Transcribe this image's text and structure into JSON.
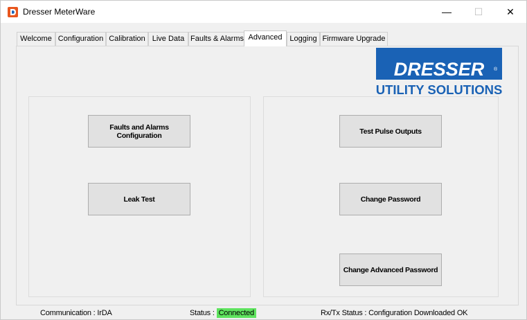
{
  "window": {
    "title": "Dresser MeterWare",
    "minimize_glyph": "—",
    "maximize_glyph": "☐",
    "close_glyph": "✕"
  },
  "tabs": [
    {
      "label": "Welcome"
    },
    {
      "label": "Configuration"
    },
    {
      "label": "Calibration"
    },
    {
      "label": "Live Data"
    },
    {
      "label": "Faults & Alarms"
    },
    {
      "label": "Advanced",
      "active": true
    },
    {
      "label": "Logging"
    },
    {
      "label": "Firmware Upgrade"
    }
  ],
  "logo": {
    "line1": "DRESSER",
    "line2": "UTILITY SOLUTIONS",
    "registered": "®",
    "brand_color": "#1a62b5"
  },
  "buttons": {
    "faults_alarms_config": "Faults and Alarms\nConfiguration",
    "leak_test": "Leak Test",
    "test_pulse_outputs": "Test Pulse Outputs",
    "change_password": "Change Password",
    "change_advanced_password": "Change Advanced Password"
  },
  "status": {
    "communication": "Communication : IrDA",
    "status_label": "Status : ",
    "status_value": "Connected",
    "status_color": "#5ee35e",
    "rxtx": "Rx/Tx Status : Configuration Downloaded OK"
  }
}
